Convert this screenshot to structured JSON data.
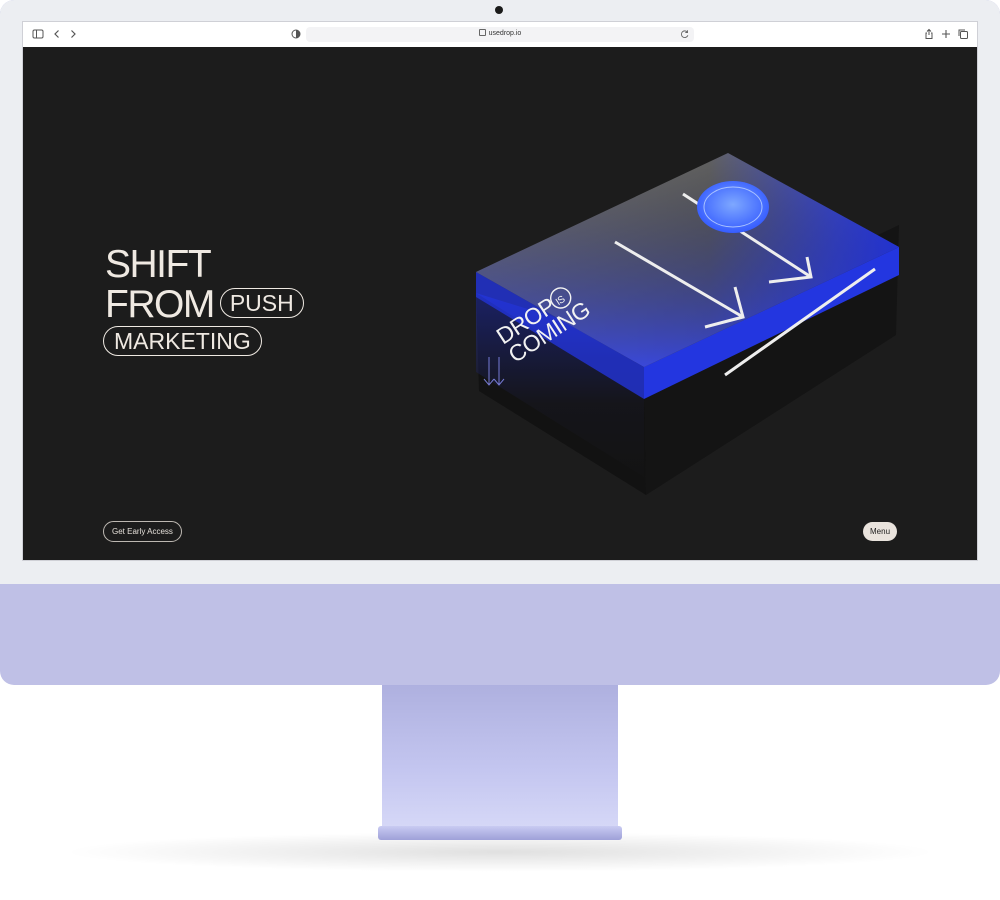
{
  "browser": {
    "url": "usedrop.io",
    "icons": [
      "sidebar-icon",
      "back-icon",
      "forward-icon",
      "privacy-icon",
      "reload-icon",
      "share-icon",
      "new-tab-icon",
      "tabs-icon"
    ]
  },
  "hero": {
    "line1": "SHIFT",
    "line2": "FROM",
    "pill1": "PUSH",
    "pill2": "MARKETING",
    "box_text_1": "DROP",
    "box_text_2": "IS",
    "box_text_3": "COMING"
  },
  "buttons": {
    "cta": "Get Early Access",
    "menu": "Menu"
  },
  "colors": {
    "page_bg": "#1c1c1c",
    "text": "#efe9e2",
    "accent": "#2a3dff",
    "monitor": "#bfc0e6"
  }
}
